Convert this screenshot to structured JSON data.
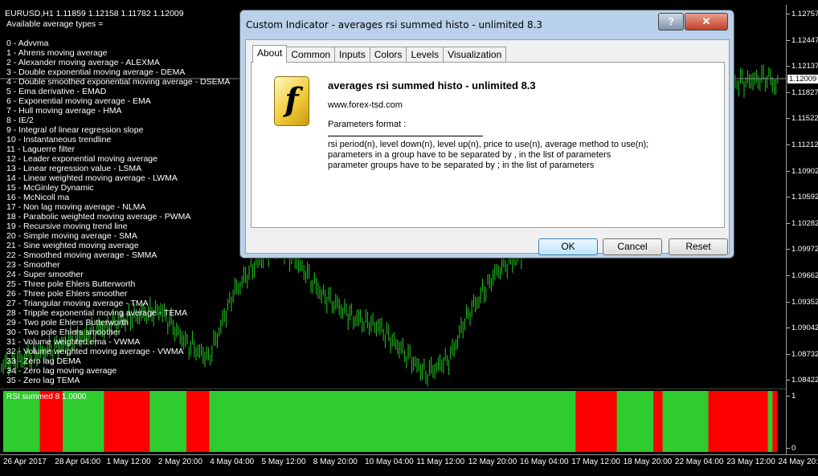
{
  "chart": {
    "symbol_line": "EURUSD,H1  1.11859 1.12158 1.11782 1.12009",
    "header": "Available average types =",
    "average_types": [
      "0 - Advvma",
      "1 - Ahrens moving average",
      "2 - Alexander moving average - ALEXMA",
      "3 - Double exponential moving average - DEMA",
      "4 - Double smoothed exponential moving average - DSEMA",
      "5 - Ema derivative - EMAD",
      "6 - Exponential moving average - EMA",
      "7 - Hull moving average - HMA",
      "8 - IE/2",
      "9 - Integral of linear regression slope",
      "10 - Instantaneous trendline",
      "11 - Laguerre filter",
      "12 - Leader exponential moving average",
      "13 - Linear regression value - LSMA",
      "14 - Linear weighted moving average - LWMA",
      "15 - McGinley Dynamic",
      "16 - McNicoll ma",
      "17 - Non lag moving average - NLMA",
      "18 - Parabolic weighted moving average - PWMA",
      "19 - Recursive moving trend line",
      "20 - Simple moving average - SMA",
      "21 - Sine weighted moving average",
      "22 - Smoothed moving average - SMMA",
      "23 - Smoother",
      "24 - Super smoother",
      "25 - Three pole Ehlers Butterworth",
      "26 - Three pole Ehlers smoother",
      "27 - Triangular moving average - TMA",
      "28 - Tripple exponential moving average - TEMA",
      "29 - Two pole Ehlers Butterworth",
      "30 - Two pole Ehlers smoother",
      "31 - Volume weighted ema - VWMA",
      "32 - Volume weighted moving average - VWMA",
      "33 - Zero lag DEMA",
      "34 - Zero lag moving average",
      "35 - Zero lag TEMA"
    ],
    "indicator_label": "RSI summed 8 1.0000",
    "price_ticks": [
      "1.12757",
      "1.12447",
      "1.12137",
      "1.11827",
      "1.11522",
      "1.11212",
      "1.10902",
      "1.10592",
      "1.10282",
      "1.09972",
      "1.09662",
      "1.09352",
      "1.09042",
      "1.08732",
      "1.08422"
    ],
    "current_price": "1.12009",
    "sub_ticks": [
      "1",
      "0"
    ],
    "time_ticks": [
      "26 Apr 2017",
      "28 Apr 04:00",
      "1 May 12:00",
      "2 May 20:00",
      "4 May 04:00",
      "5 May 12:00",
      "8 May 20:00",
      "10 May 04:00",
      "11 May 12:00",
      "12 May 20:00",
      "16 May 04:00",
      "17 May 12:00",
      "18 May 20:00",
      "22 May 04:00",
      "23 May 12:00",
      "24 May 20:00"
    ],
    "colors": {
      "bull": "#22cc22",
      "up": "#2ecc2e",
      "down": "#ff0000",
      "background": "#000000"
    },
    "histogram_states": [
      "g",
      "g",
      "g",
      "g",
      "g",
      "g",
      "g",
      "g",
      "r",
      "r",
      "r",
      "r",
      "r",
      "g",
      "g",
      "g",
      "g",
      "g",
      "g",
      "g",
      "g",
      "g",
      "r",
      "r",
      "r",
      "r",
      "r",
      "r",
      "r",
      "r",
      "r",
      "r",
      "g",
      "g",
      "g",
      "g",
      "g",
      "g",
      "g",
      "g",
      "r",
      "r",
      "r",
      "r",
      "r",
      "g",
      "g",
      "g",
      "g",
      "g",
      "g",
      "g",
      "g",
      "g",
      "g",
      "g",
      "g",
      "g",
      "g",
      "g",
      "g",
      "g",
      "g",
      "g",
      "g",
      "g",
      "g",
      "g",
      "g",
      "g",
      "g",
      "g",
      "g",
      "g",
      "g",
      "g",
      "g",
      "g",
      "g",
      "g",
      "g",
      "g",
      "g",
      "g",
      "g",
      "g",
      "g",
      "g",
      "g",
      "g",
      "g",
      "g",
      "g",
      "g",
      "g",
      "g",
      "g",
      "g",
      "g",
      "g",
      "g",
      "g",
      "g",
      "g",
      "g",
      "g",
      "g",
      "g",
      "g",
      "g",
      "g",
      "g",
      "g",
      "g",
      "g",
      "g",
      "g",
      "g",
      "g",
      "g",
      "g",
      "g",
      "g",
      "g",
      "g",
      "r",
      "r",
      "r",
      "r",
      "r",
      "r",
      "r",
      "r",
      "r",
      "g",
      "g",
      "g",
      "g",
      "g",
      "g",
      "g",
      "g",
      "r",
      "r",
      "g",
      "g",
      "g",
      "g",
      "g",
      "g",
      "g",
      "g",
      "g",
      "g",
      "r",
      "r",
      "r",
      "r",
      "r",
      "r",
      "r",
      "r",
      "r",
      "r",
      "r",
      "r",
      "r",
      "g",
      "r"
    ]
  },
  "dialog": {
    "title": "Custom Indicator - averages rsi summed histo - unlimited 8.3",
    "help_icon": "?",
    "close_icon": "✕",
    "tabs": [
      "About",
      "Common",
      "Inputs",
      "Colors",
      "Levels",
      "Visualization"
    ],
    "active_tab": "About",
    "logo_glyph": "f",
    "indicator_name": "averages rsi summed histo - unlimited 8.3",
    "site": "www.forex-tsd.com",
    "format_label": "Parameters format :",
    "description": [
      "rsi period(n), level down(n), level up(n), price to use(n), average method to use(n);",
      "parameters in a group have to be separated by , in the list of parameters",
      "parameter groups have to be separated by ; in the list of parameters"
    ],
    "ok_label": "OK",
    "cancel_label": "Cancel",
    "reset_label": "Reset"
  }
}
